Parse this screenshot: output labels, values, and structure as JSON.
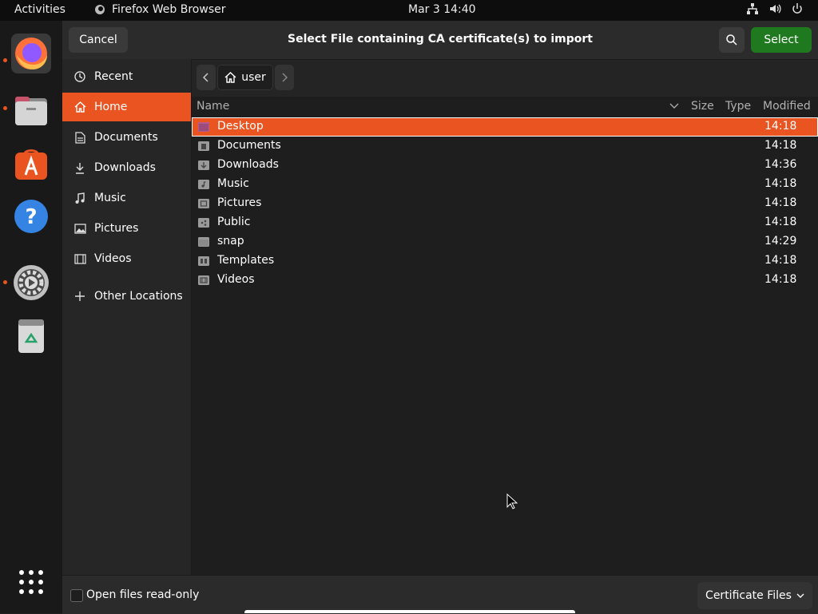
{
  "topbar": {
    "activities": "Activities",
    "app_name": "Firefox Web Browser",
    "clock": "Mar 3  14:40",
    "tray_icons": [
      "network-icon",
      "volume-icon",
      "power-icon"
    ]
  },
  "dock": {
    "apps": [
      {
        "name": "firefox-icon",
        "active": true
      },
      {
        "name": "files-icon",
        "active": false
      },
      {
        "name": "app-center-icon",
        "active": false
      },
      {
        "name": "help-icon",
        "active": false
      },
      {
        "name": "settings-icon",
        "active": false
      },
      {
        "name": "trash-icon",
        "active": false
      }
    ],
    "show_apps_icon": "grid-icon"
  },
  "dialog": {
    "title": "Select File containing CA certificate(s) to import",
    "cancel_label": "Cancel",
    "select_label": "Select",
    "accent_color": "#e95420",
    "select_color": "#1f7a1f"
  },
  "sidebar": {
    "items": [
      {
        "label": "Recent",
        "icon": "clock-icon"
      },
      {
        "label": "Home",
        "icon": "home-icon",
        "active": true
      },
      {
        "label": "Documents",
        "icon": "document-icon"
      },
      {
        "label": "Downloads",
        "icon": "download-icon"
      },
      {
        "label": "Music",
        "icon": "music-icon"
      },
      {
        "label": "Pictures",
        "icon": "picture-icon"
      },
      {
        "label": "Videos",
        "icon": "video-icon"
      },
      {
        "label": "Other Locations",
        "icon": "plus-icon"
      }
    ]
  },
  "pathbar": {
    "current": "user"
  },
  "filelist": {
    "columns": {
      "name": "Name",
      "size": "Size",
      "type": "Type",
      "modified": "Modified"
    },
    "rows": [
      {
        "name": "Desktop",
        "time": "14:18",
        "selected": true
      },
      {
        "name": "Documents",
        "time": "14:18"
      },
      {
        "name": "Downloads",
        "time": "14:36"
      },
      {
        "name": "Music",
        "time": "14:18"
      },
      {
        "name": "Pictures",
        "time": "14:18"
      },
      {
        "name": "Public",
        "time": "14:18"
      },
      {
        "name": "snap",
        "time": "14:29"
      },
      {
        "name": "Templates",
        "time": "14:18"
      },
      {
        "name": "Videos",
        "time": "14:18"
      }
    ]
  },
  "footer": {
    "readonly_label": "Open files read-only",
    "filter_label": "Certificate Files"
  }
}
